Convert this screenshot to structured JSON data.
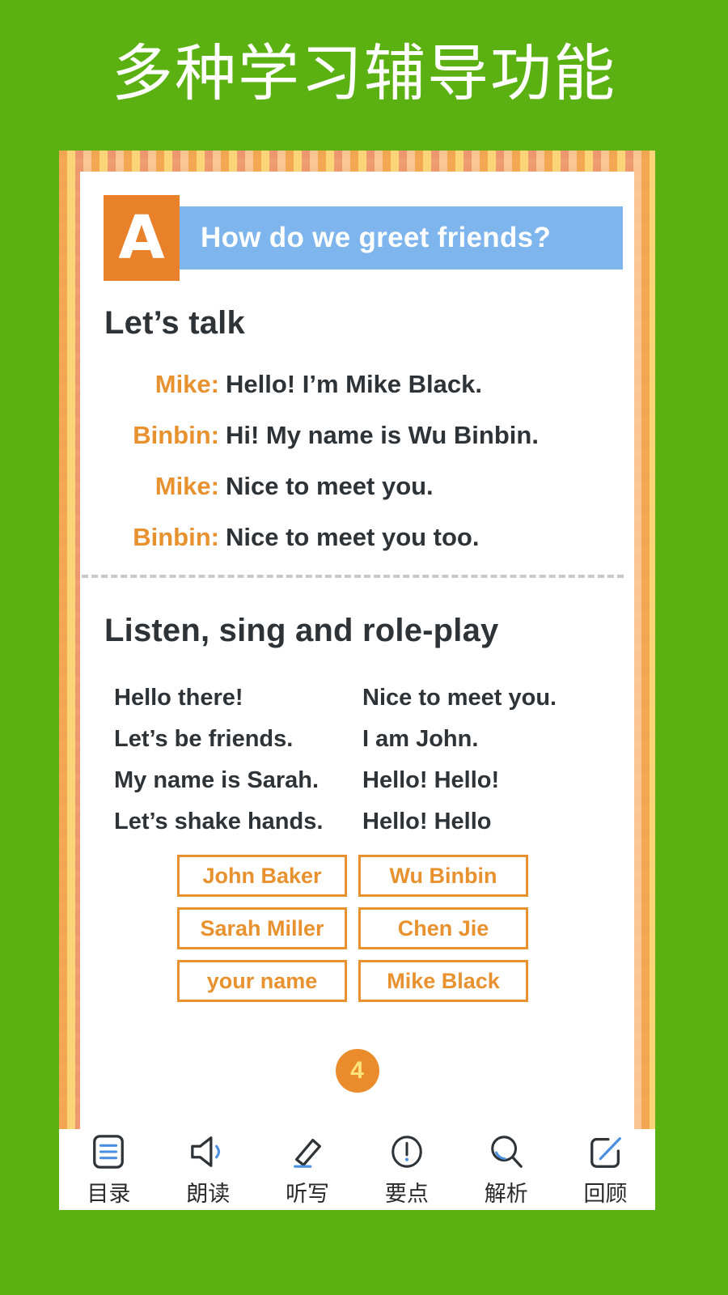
{
  "page_title": "多种学习辅导功能",
  "theme": {
    "background_green": "#5cb112",
    "accent_orange": "#e8912f",
    "title_bar_blue": "#7fb5ed",
    "text_dark": "#2e3338"
  },
  "section": {
    "letter": "A",
    "title": "How do we greet friends?"
  },
  "lets_talk": {
    "heading": "Let’s talk",
    "lines": [
      {
        "speaker": "Mike:",
        "text": "Hello! I’m Mike Black."
      },
      {
        "speaker": "Binbin:",
        "text": "Hi! My name is Wu Binbin."
      },
      {
        "speaker": "Mike:",
        "text": "Nice to meet you."
      },
      {
        "speaker": "Binbin:",
        "text": "Nice to meet you too."
      }
    ]
  },
  "roleplay": {
    "heading": "Listen, sing and role-play",
    "song_left": [
      "Hello there!",
      "Let’s be friends.",
      "My name is Sarah.",
      "Let’s shake hands."
    ],
    "song_right": [
      "Nice to meet you.",
      "I am John.",
      "Hello! Hello!",
      "Hello! Hello"
    ],
    "names": [
      "John Baker",
      "Wu Binbin",
      "Sarah Miller",
      "Chen Jie",
      "your name",
      "Mike Black"
    ]
  },
  "page_number": "4",
  "toolbar": {
    "items": [
      {
        "icon": "contents-icon",
        "label": "目录"
      },
      {
        "icon": "speaker-icon",
        "label": "朗读"
      },
      {
        "icon": "pencil-icon",
        "label": "听写"
      },
      {
        "icon": "exclamation-circle-icon",
        "label": "要点"
      },
      {
        "icon": "magnifier-icon",
        "label": "解析"
      },
      {
        "icon": "edit-square-icon",
        "label": "回顾"
      }
    ]
  }
}
